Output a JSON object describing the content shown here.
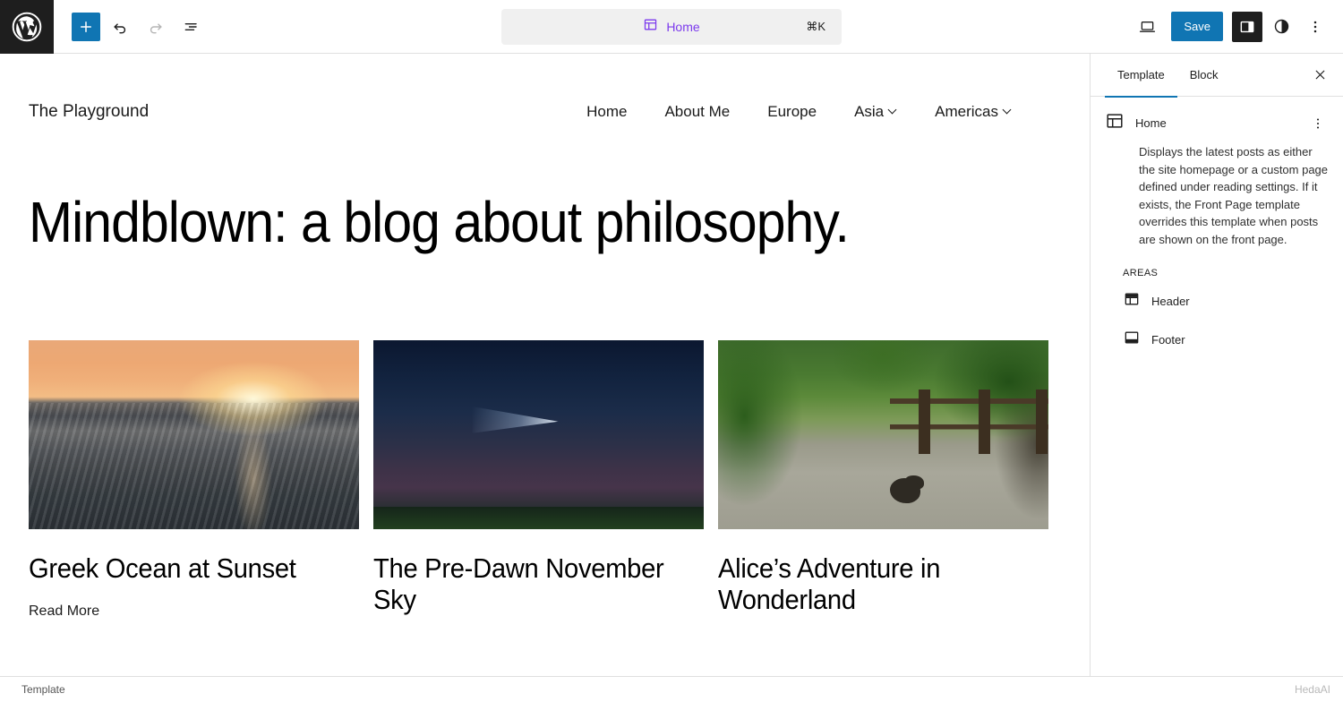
{
  "topbar": {
    "logo_icon": "wordpress-logo-icon",
    "add_block_label": "+",
    "undo_icon": "undo-icon",
    "redo_icon": "redo-icon",
    "list_view_icon": "list-view-icon",
    "command_bar": {
      "icon": "template-icon",
      "label": "Home",
      "shortcut": "⌘K"
    },
    "view_icon": "desktop-view-icon",
    "save_label": "Save",
    "settings_icon": "settings-sidebar-icon",
    "styles_icon": "styles-contrast-icon",
    "options_icon": "more-options-icon"
  },
  "site": {
    "title": "The Playground",
    "nav": [
      {
        "label": "Home",
        "has_submenu": false
      },
      {
        "label": "About Me",
        "has_submenu": false
      },
      {
        "label": "Europe",
        "has_submenu": false
      },
      {
        "label": "Asia",
        "has_submenu": true
      },
      {
        "label": "Americas",
        "has_submenu": true
      }
    ],
    "heading": "Mindblown: a blog about philosophy.",
    "posts": [
      {
        "title": "Greek Ocean at Sunset",
        "image": "ocean-sunset-photo",
        "read_more": "Read More"
      },
      {
        "title": "The Pre-Dawn November Sky",
        "image": "night-sky-comet-photo",
        "read_more": ""
      },
      {
        "title": "Alice’s Adventure in Wonderland",
        "image": "rabbit-on-path-photo",
        "read_more": ""
      }
    ]
  },
  "sidebar": {
    "tabs": [
      {
        "label": "Template",
        "active": true
      },
      {
        "label": "Block",
        "active": false
      }
    ],
    "close_icon": "close-icon",
    "template": {
      "icon": "template-icon",
      "name": "Home",
      "more_icon": "more-actions-icon",
      "description": "Displays the latest posts as either the site homepage or a custom page defined under reading settings. If it exists, the Front Page template overrides this template when posts are shown on the front page."
    },
    "areas_label": "AREAS",
    "areas": [
      {
        "label": "Header",
        "icon": "header-area-icon"
      },
      {
        "label": "Footer",
        "icon": "footer-area-icon"
      }
    ]
  },
  "statusbar": {
    "document_label": "Template"
  },
  "watermarks": {
    "center": "HedaAI",
    "corner": "HedaAI"
  },
  "colors": {
    "accent_blue": "#1075b3",
    "command_purple": "#7c3aed",
    "logo_bg": "#1e1e1e"
  }
}
